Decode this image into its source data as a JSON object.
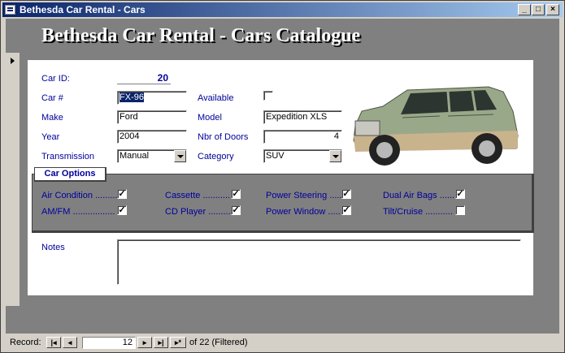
{
  "window": {
    "title": "Bethesda Car Rental - Cars"
  },
  "header": {
    "banner": "Bethesda Car Rental - Cars Catalogue"
  },
  "form": {
    "car_id": {
      "label": "Car ID:",
      "value": "20"
    },
    "car_number": {
      "label": "Car #",
      "value": "FX-96"
    },
    "make": {
      "label": "Make",
      "value": "Ford"
    },
    "year": {
      "label": "Year",
      "value": "2004"
    },
    "transmission": {
      "label": "Transmission",
      "value": "Manual"
    },
    "available": {
      "label": "Available",
      "checked": false
    },
    "model": {
      "label": "Model",
      "value": "Expedition XLS"
    },
    "doors": {
      "label": "Nbr of Doors",
      "value": "4"
    },
    "category": {
      "label": "Category",
      "value": "SUV"
    },
    "notes": {
      "label": "Notes",
      "value": ""
    }
  },
  "options": {
    "title": "Car Options",
    "items": [
      {
        "label": "Air Condition .........",
        "checked": true
      },
      {
        "label": "AM/FM .................",
        "checked": true
      },
      {
        "label": "Cassette ...........",
        "checked": true
      },
      {
        "label": "CD Player .........",
        "checked": true
      },
      {
        "label": "Power Steering .....",
        "checked": true
      },
      {
        "label": "Power Window .....",
        "checked": true
      },
      {
        "label": "Dual Air Bags ......",
        "checked": true
      },
      {
        "label": "Tilt/Cruise ...........",
        "checked": false
      }
    ]
  },
  "nav": {
    "record_label": "Record:",
    "current": "12",
    "of_text": "of  22 (Filtered)"
  },
  "colors": {
    "label": "#00009c",
    "title_bar": "#0a246a",
    "car_body": "#9aa88a"
  }
}
